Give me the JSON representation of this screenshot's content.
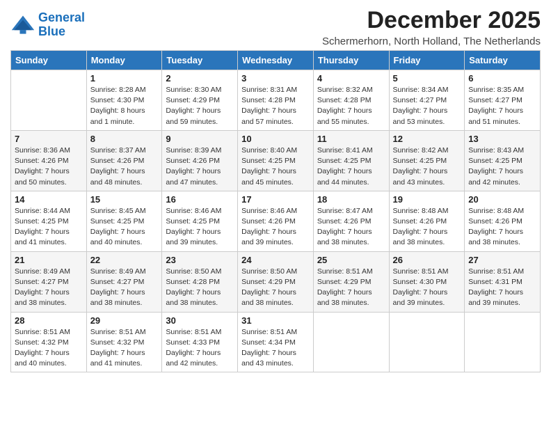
{
  "logo": {
    "line1": "General",
    "line2": "Blue"
  },
  "title": "December 2025",
  "location": "Schermerhorn, North Holland, The Netherlands",
  "weekdays": [
    "Sunday",
    "Monday",
    "Tuesday",
    "Wednesday",
    "Thursday",
    "Friday",
    "Saturday"
  ],
  "weeks": [
    [
      {
        "day": "",
        "sunrise": "",
        "sunset": "",
        "daylight": ""
      },
      {
        "day": "1",
        "sunrise": "Sunrise: 8:28 AM",
        "sunset": "Sunset: 4:30 PM",
        "daylight": "Daylight: 8 hours and 1 minute."
      },
      {
        "day": "2",
        "sunrise": "Sunrise: 8:30 AM",
        "sunset": "Sunset: 4:29 PM",
        "daylight": "Daylight: 7 hours and 59 minutes."
      },
      {
        "day": "3",
        "sunrise": "Sunrise: 8:31 AM",
        "sunset": "Sunset: 4:28 PM",
        "daylight": "Daylight: 7 hours and 57 minutes."
      },
      {
        "day": "4",
        "sunrise": "Sunrise: 8:32 AM",
        "sunset": "Sunset: 4:28 PM",
        "daylight": "Daylight: 7 hours and 55 minutes."
      },
      {
        "day": "5",
        "sunrise": "Sunrise: 8:34 AM",
        "sunset": "Sunset: 4:27 PM",
        "daylight": "Daylight: 7 hours and 53 minutes."
      },
      {
        "day": "6",
        "sunrise": "Sunrise: 8:35 AM",
        "sunset": "Sunset: 4:27 PM",
        "daylight": "Daylight: 7 hours and 51 minutes."
      }
    ],
    [
      {
        "day": "7",
        "sunrise": "Sunrise: 8:36 AM",
        "sunset": "Sunset: 4:26 PM",
        "daylight": "Daylight: 7 hours and 50 minutes."
      },
      {
        "day": "8",
        "sunrise": "Sunrise: 8:37 AM",
        "sunset": "Sunset: 4:26 PM",
        "daylight": "Daylight: 7 hours and 48 minutes."
      },
      {
        "day": "9",
        "sunrise": "Sunrise: 8:39 AM",
        "sunset": "Sunset: 4:26 PM",
        "daylight": "Daylight: 7 hours and 47 minutes."
      },
      {
        "day": "10",
        "sunrise": "Sunrise: 8:40 AM",
        "sunset": "Sunset: 4:25 PM",
        "daylight": "Daylight: 7 hours and 45 minutes."
      },
      {
        "day": "11",
        "sunrise": "Sunrise: 8:41 AM",
        "sunset": "Sunset: 4:25 PM",
        "daylight": "Daylight: 7 hours and 44 minutes."
      },
      {
        "day": "12",
        "sunrise": "Sunrise: 8:42 AM",
        "sunset": "Sunset: 4:25 PM",
        "daylight": "Daylight: 7 hours and 43 minutes."
      },
      {
        "day": "13",
        "sunrise": "Sunrise: 8:43 AM",
        "sunset": "Sunset: 4:25 PM",
        "daylight": "Daylight: 7 hours and 42 minutes."
      }
    ],
    [
      {
        "day": "14",
        "sunrise": "Sunrise: 8:44 AM",
        "sunset": "Sunset: 4:25 PM",
        "daylight": "Daylight: 7 hours and 41 minutes."
      },
      {
        "day": "15",
        "sunrise": "Sunrise: 8:45 AM",
        "sunset": "Sunset: 4:25 PM",
        "daylight": "Daylight: 7 hours and 40 minutes."
      },
      {
        "day": "16",
        "sunrise": "Sunrise: 8:46 AM",
        "sunset": "Sunset: 4:25 PM",
        "daylight": "Daylight: 7 hours and 39 minutes."
      },
      {
        "day": "17",
        "sunrise": "Sunrise: 8:46 AM",
        "sunset": "Sunset: 4:26 PM",
        "daylight": "Daylight: 7 hours and 39 minutes."
      },
      {
        "day": "18",
        "sunrise": "Sunrise: 8:47 AM",
        "sunset": "Sunset: 4:26 PM",
        "daylight": "Daylight: 7 hours and 38 minutes."
      },
      {
        "day": "19",
        "sunrise": "Sunrise: 8:48 AM",
        "sunset": "Sunset: 4:26 PM",
        "daylight": "Daylight: 7 hours and 38 minutes."
      },
      {
        "day": "20",
        "sunrise": "Sunrise: 8:48 AM",
        "sunset": "Sunset: 4:26 PM",
        "daylight": "Daylight: 7 hours and 38 minutes."
      }
    ],
    [
      {
        "day": "21",
        "sunrise": "Sunrise: 8:49 AM",
        "sunset": "Sunset: 4:27 PM",
        "daylight": "Daylight: 7 hours and 38 minutes."
      },
      {
        "day": "22",
        "sunrise": "Sunrise: 8:49 AM",
        "sunset": "Sunset: 4:27 PM",
        "daylight": "Daylight: 7 hours and 38 minutes."
      },
      {
        "day": "23",
        "sunrise": "Sunrise: 8:50 AM",
        "sunset": "Sunset: 4:28 PM",
        "daylight": "Daylight: 7 hours and 38 minutes."
      },
      {
        "day": "24",
        "sunrise": "Sunrise: 8:50 AM",
        "sunset": "Sunset: 4:29 PM",
        "daylight": "Daylight: 7 hours and 38 minutes."
      },
      {
        "day": "25",
        "sunrise": "Sunrise: 8:51 AM",
        "sunset": "Sunset: 4:29 PM",
        "daylight": "Daylight: 7 hours and 38 minutes."
      },
      {
        "day": "26",
        "sunrise": "Sunrise: 8:51 AM",
        "sunset": "Sunset: 4:30 PM",
        "daylight": "Daylight: 7 hours and 39 minutes."
      },
      {
        "day": "27",
        "sunrise": "Sunrise: 8:51 AM",
        "sunset": "Sunset: 4:31 PM",
        "daylight": "Daylight: 7 hours and 39 minutes."
      }
    ],
    [
      {
        "day": "28",
        "sunrise": "Sunrise: 8:51 AM",
        "sunset": "Sunset: 4:32 PM",
        "daylight": "Daylight: 7 hours and 40 minutes."
      },
      {
        "day": "29",
        "sunrise": "Sunrise: 8:51 AM",
        "sunset": "Sunset: 4:32 PM",
        "daylight": "Daylight: 7 hours and 41 minutes."
      },
      {
        "day": "30",
        "sunrise": "Sunrise: 8:51 AM",
        "sunset": "Sunset: 4:33 PM",
        "daylight": "Daylight: 7 hours and 42 minutes."
      },
      {
        "day": "31",
        "sunrise": "Sunrise: 8:51 AM",
        "sunset": "Sunset: 4:34 PM",
        "daylight": "Daylight: 7 hours and 43 minutes."
      },
      {
        "day": "",
        "sunrise": "",
        "sunset": "",
        "daylight": ""
      },
      {
        "day": "",
        "sunrise": "",
        "sunset": "",
        "daylight": ""
      },
      {
        "day": "",
        "sunrise": "",
        "sunset": "",
        "daylight": ""
      }
    ]
  ]
}
